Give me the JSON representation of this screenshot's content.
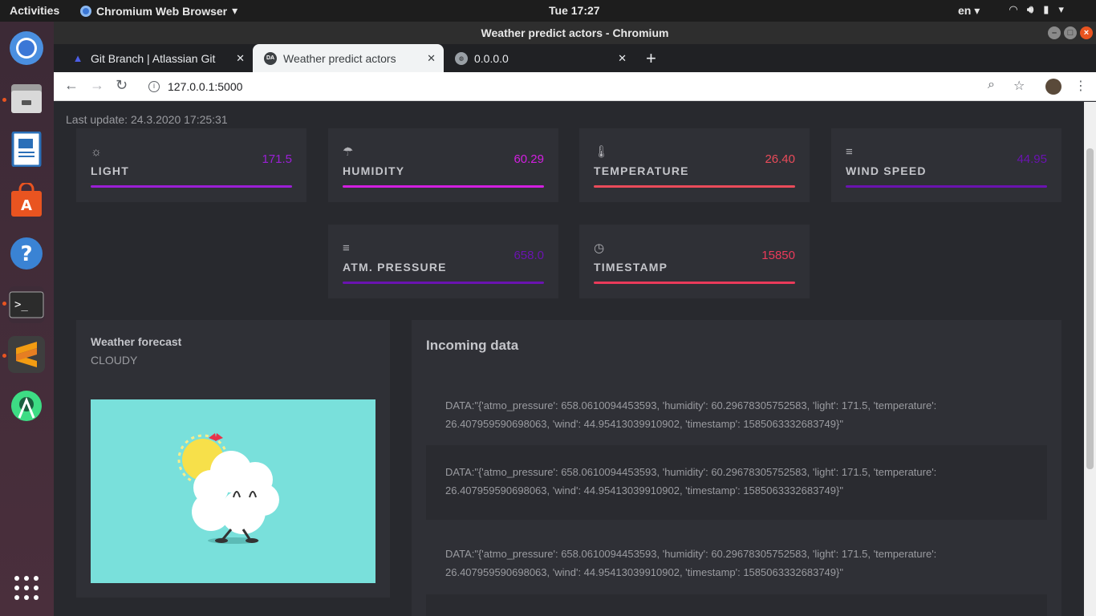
{
  "topbar": {
    "activities": "Activities",
    "app_name": "Chromium Web Browser",
    "clock": "Tue 17:27",
    "lang": "en"
  },
  "window": {
    "title": "Weather predict actors - Chromium"
  },
  "tabs": [
    {
      "label": "Git Branch | Atlassian Git",
      "icon": "atlassian-icon"
    },
    {
      "label": "Weather predict actors",
      "icon": "DA"
    },
    {
      "label": "0.0.0.0",
      "icon": "globe-icon"
    }
  ],
  "address": {
    "url": "127.0.0.1:5000"
  },
  "page": {
    "last_update": "Last update: 24.3.2020 17:25:31",
    "cards": [
      {
        "label": "LIGHT",
        "value": "171.5",
        "icon": "sun-icon",
        "color": "#9b1fd6"
      },
      {
        "label": "HUMIDITY",
        "value": "60.29",
        "icon": "umbrella-icon",
        "color": "#d21fe0"
      },
      {
        "label": "TEMPERATURE",
        "value": "26.40",
        "icon": "thermometer-icon",
        "color": "#ea4b5a"
      },
      {
        "label": "WIND SPEED",
        "value": "44.95",
        "icon": "menu-icon",
        "color": "#6a13b0"
      },
      {
        "label": "ATM. PRESSURE",
        "value": "658.0",
        "icon": "menu-icon",
        "color": "#6a13b0"
      },
      {
        "label": "TIMESTAMP",
        "value": "15850",
        "icon": "clock-icon",
        "color": "#ea3a5a"
      }
    ],
    "forecast": {
      "title": "Weather forecast",
      "value": "CLOUDY"
    },
    "incoming": {
      "title": "Incoming data",
      "messages": [
        "DATA:\"{'atmo_pressure': 658.0610094453593, 'humidity': 60.29678305752583, 'light': 171.5, 'temperature': 26.407959590698063, 'wind': 44.95413039910902, 'timestamp': 1585063332683749}\"",
        "DATA:\"{'atmo_pressure': 658.0610094453593, 'humidity': 60.29678305752583, 'light': 171.5, 'temperature': 26.407959590698063, 'wind': 44.95413039910902, 'timestamp': 1585063332683749}\"",
        "DATA:\"{'atmo_pressure': 658.0610094453593, 'humidity': 60.29678305752583, 'light': 171.5, 'temperature': 26.407959590698063, 'wind': 44.95413039910902, 'timestamp': 1585063332683749}\""
      ]
    }
  }
}
